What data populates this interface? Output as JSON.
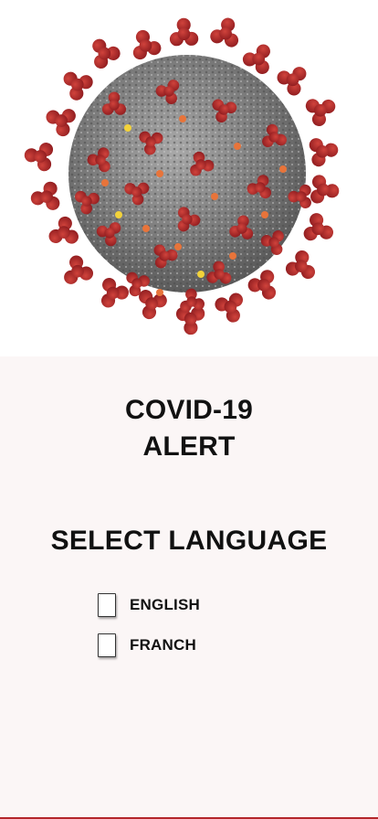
{
  "header": {
    "image_alt": "coronavirus illustration"
  },
  "alert": {
    "title_line1": "COVID-19",
    "title_line2": "ALERT"
  },
  "language": {
    "heading": "SELECT LANGUAGE",
    "options": [
      {
        "label": "ENGLISH",
        "checked": false
      },
      {
        "label": "FRANCH",
        "checked": false
      }
    ]
  },
  "colors": {
    "background": "#fbf6f6",
    "virus_body": "#8c8c8c",
    "spike": "#b02a2a",
    "accent_line": "#b3262a"
  }
}
